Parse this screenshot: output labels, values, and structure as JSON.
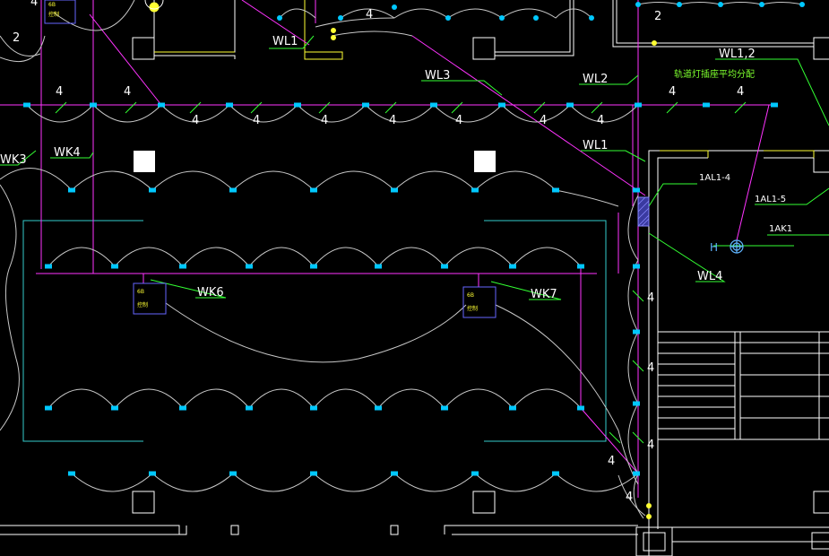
{
  "colors": {
    "background": "#000000",
    "wall": "#ffffff",
    "cable": "#ff33ff",
    "fixture": "#00c8ff",
    "arc": "#c8c8c8",
    "leader": "#33ff33",
    "boundary": "#33cccc",
    "panel": "#6666ff",
    "switch": "#ffff33",
    "note": "#7dff2e",
    "outlet": "#5fb4ff"
  },
  "labels": {
    "wl1_top": "WL1",
    "wl3": "WL3",
    "wl2": "WL2",
    "wl1_mid": "WL1",
    "wl12": "WL1,2",
    "note_cn": "轨道灯插座平均分配",
    "wk3": "WK3",
    "wk4": "WK4",
    "wk6": "WK6",
    "wk7": "WK7",
    "al14": "1AL1-4",
    "al15": "1AL1-5",
    "ak1": "1AK1",
    "wl4": "WL4",
    "h": "H",
    "count_2": "2",
    "count_4": "4",
    "panel_code": "6B",
    "panel_sub": "控制"
  }
}
